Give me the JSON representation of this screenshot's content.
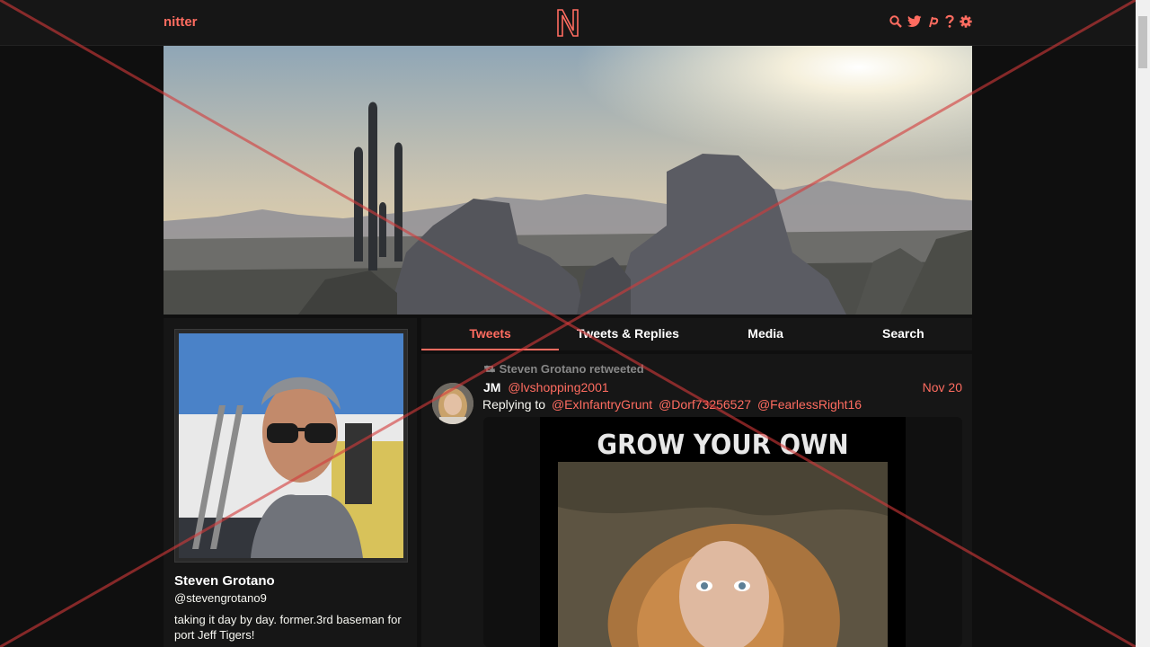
{
  "navbar": {
    "brand": "nitter",
    "logo": "N",
    "icons": [
      "search-icon",
      "twitter-bird-icon",
      "rss-icon",
      "help-icon",
      "gear-icon"
    ],
    "accent": "#ff6c60"
  },
  "profile": {
    "fullname": "Steven Grotano",
    "username": "@stevengrotano9",
    "bio": "taking it day by day.  former.3rd baseman for port Jeff Tigers!"
  },
  "tabs": [
    {
      "label": "Tweets",
      "active": true
    },
    {
      "label": "Tweets & Replies",
      "active": false
    },
    {
      "label": "Media",
      "active": false
    },
    {
      "label": "Search",
      "active": false
    }
  ],
  "tweet": {
    "retweet_label": "Steven Grotano retweeted",
    "name": "JM",
    "handle": "@lvshopping2001",
    "date": "Nov 20",
    "replying_prefix": "Replying to",
    "replying_to": [
      "@ExInfantryGrunt",
      "@Dorf73256527",
      "@FearlessRight16"
    ],
    "media_caption": "GROW YOUR OWN DOPE"
  },
  "colors": {
    "background": "#0f0f0f",
    "panel": "#161616",
    "accent": "#ff6c60",
    "overlay_x": "#d43a3a"
  }
}
